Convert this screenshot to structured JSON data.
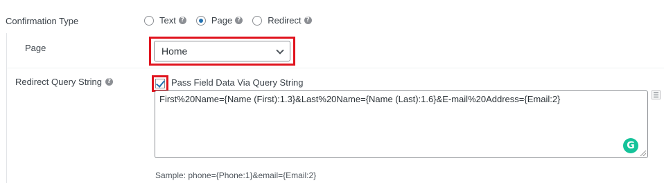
{
  "confirmation_type": {
    "label": "Confirmation Type",
    "options": [
      {
        "label": "Text",
        "checked": false
      },
      {
        "label": "Page",
        "checked": true
      },
      {
        "label": "Redirect",
        "checked": false
      }
    ]
  },
  "page": {
    "label": "Page",
    "selected": "Home"
  },
  "redirect_query": {
    "label": "Redirect Query String",
    "checkbox_label": "Pass Field Data Via Query String",
    "checkbox_checked": true,
    "value": "First%20Name={Name (First):1.3}&Last%20Name={Name (Last):1.6}&E-mail%20Address={Email:2}",
    "sample": "Sample: phone={Phone:1}&email={Email:2}"
  },
  "icons": {
    "help": "question-circle-icon",
    "grammarly": "grammarly-icon",
    "merge_tags": "merge-tags-icon",
    "chevron": "chevron-down-icon"
  },
  "colors": {
    "highlight": "#e0141e",
    "accent": "#2271b1",
    "grammarly": "#15c39a"
  }
}
